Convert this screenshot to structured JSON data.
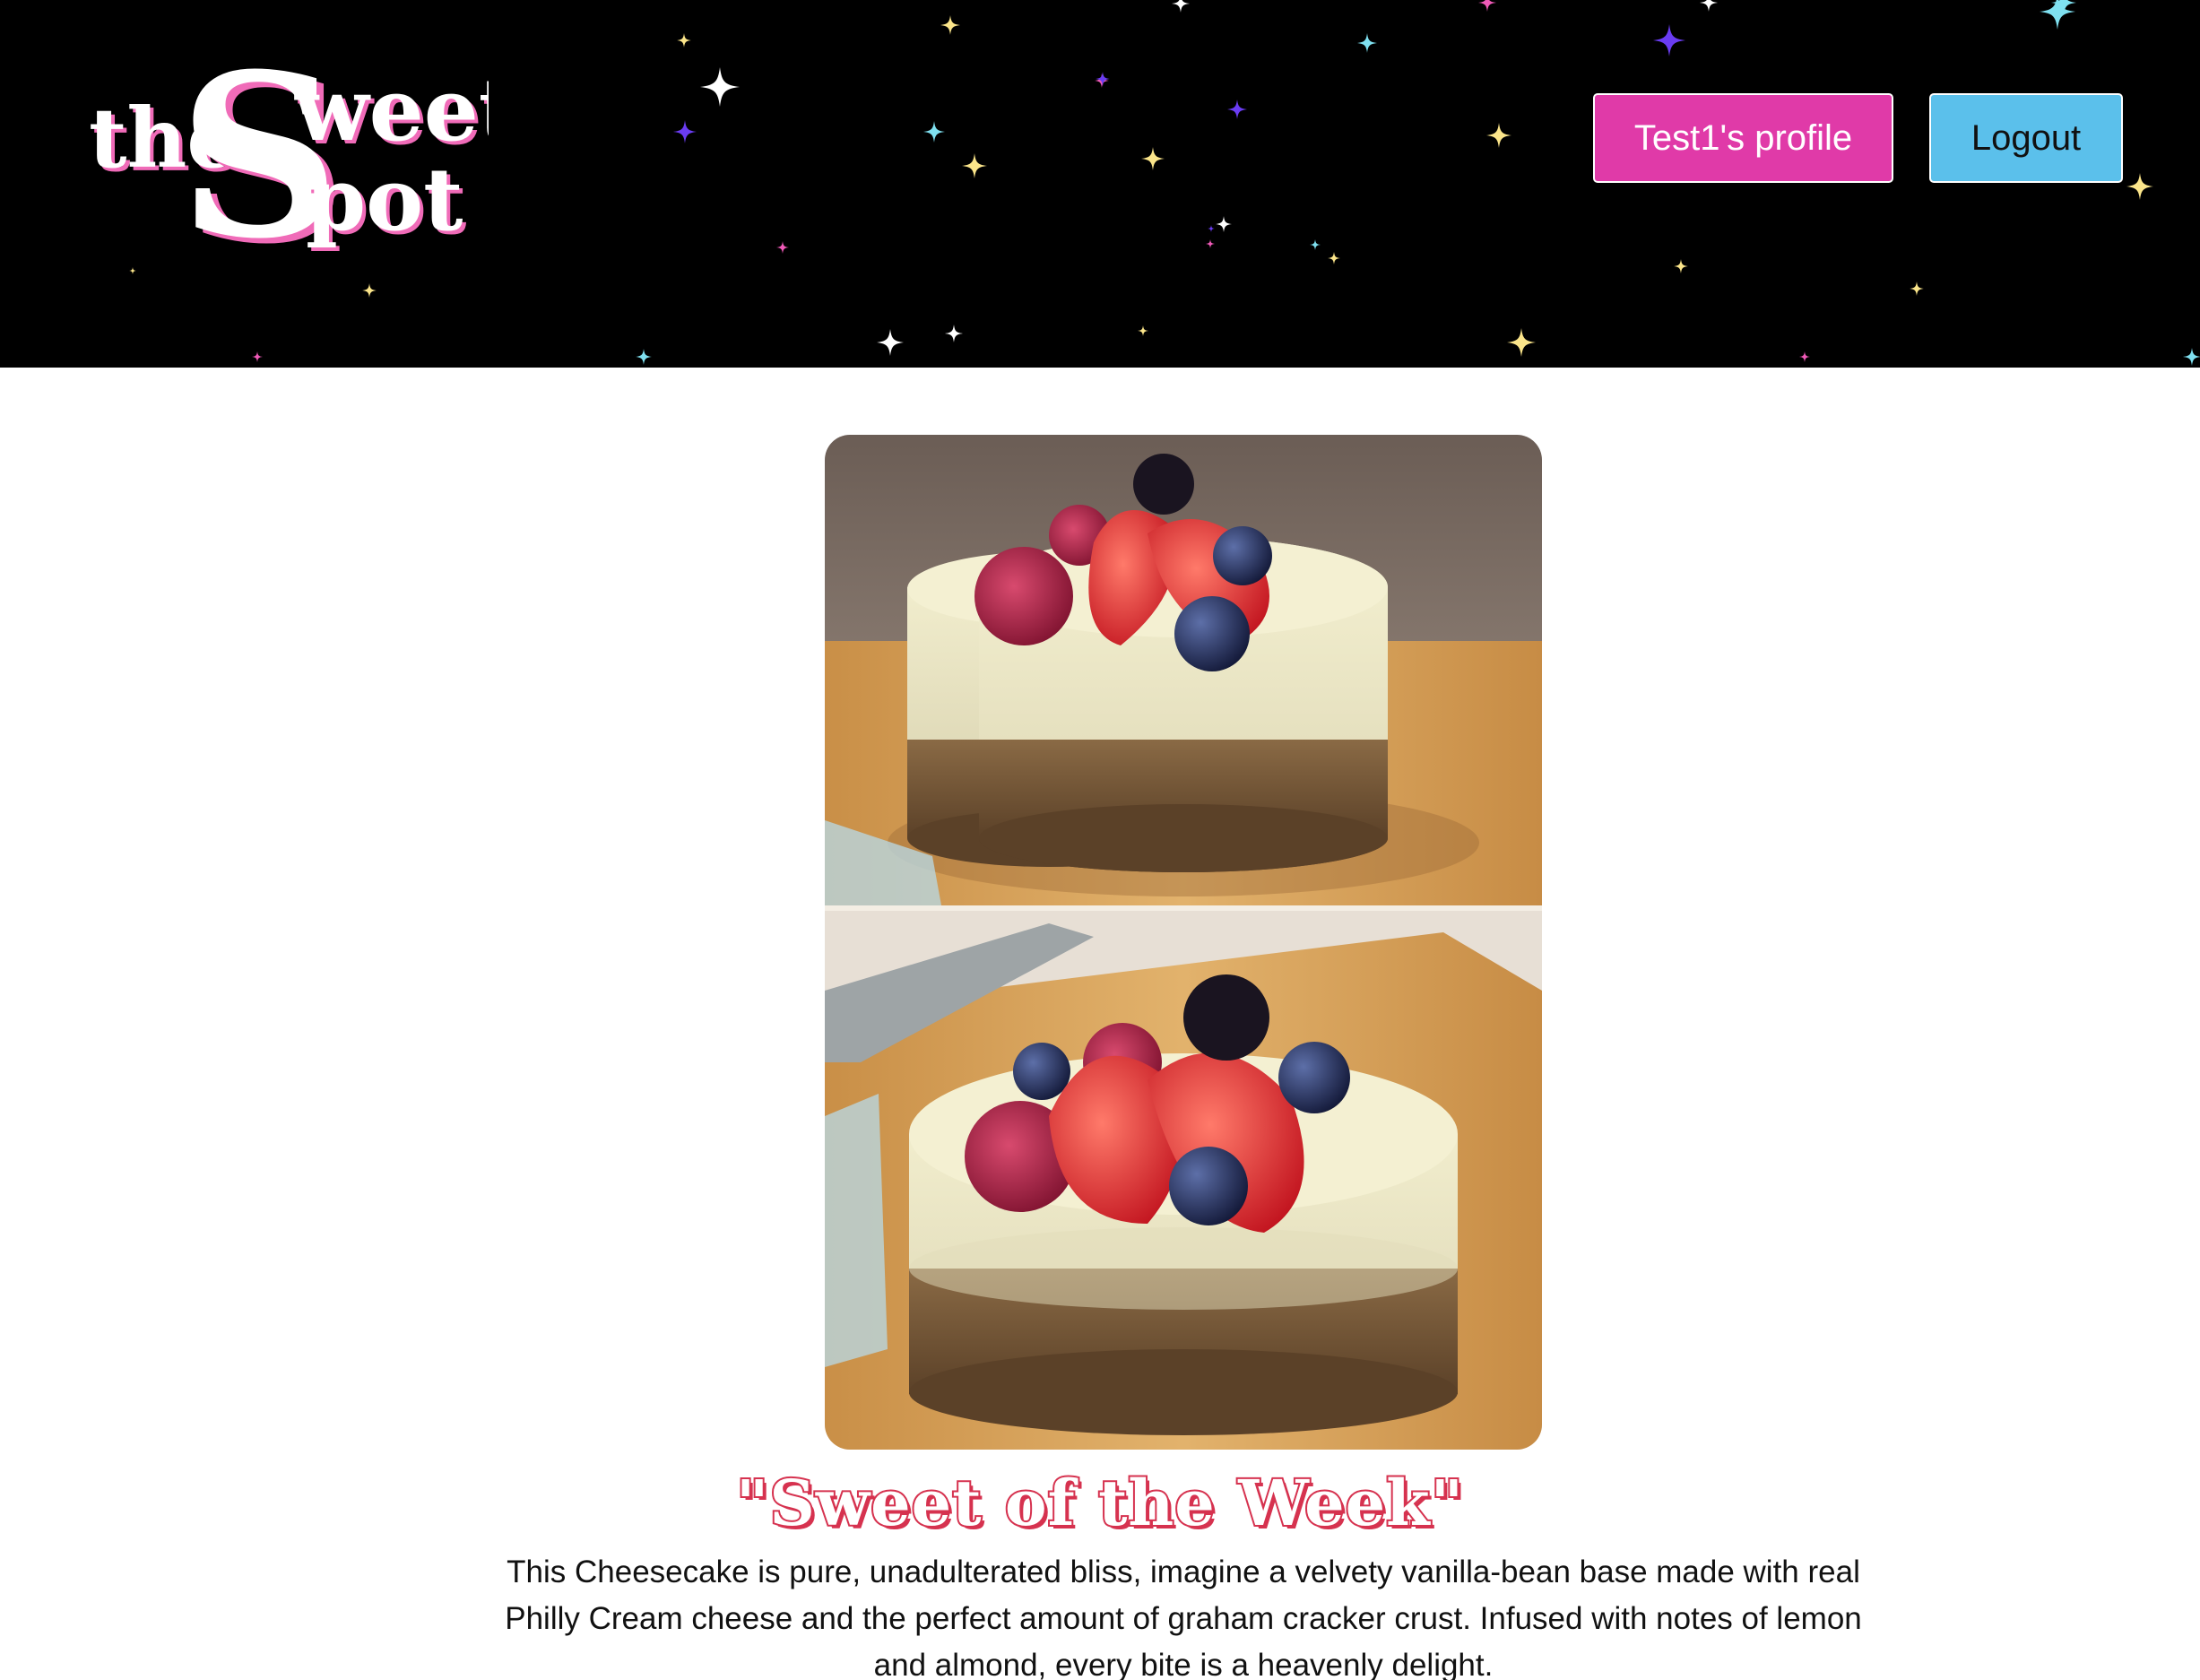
{
  "header": {
    "logo": {
      "word_the": "the",
      "word_s": "S",
      "word_weet": "weet",
      "word_pot": "pot"
    },
    "profile_button_label": "Test1's profile",
    "logout_button_label": "Logout"
  },
  "feature": {
    "headline": "\"Sweet of the Week\"",
    "description": "This Cheesecake is pure, unadulterated bliss, imagine a velvety vanilla-bean base made with real Philly Cream cheese and the perfect amount of graham cracker crust. Infused with notes of lemon and almond, every bite is a heavenly delight."
  },
  "colors": {
    "profile_button": "#e03aa8",
    "logout_button": "#5bc0eb",
    "headline_outline": "#d6324f",
    "logo_accent": "#f06bb8",
    "header_bg": "#000000"
  }
}
